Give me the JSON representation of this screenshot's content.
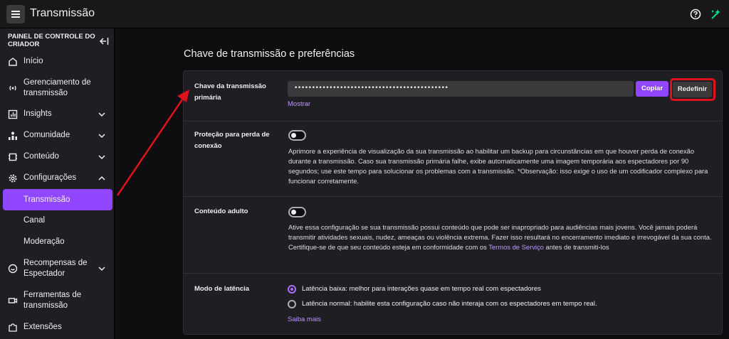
{
  "header": {
    "title": "Transmissão",
    "menu_icon": "hamburger-menu-icon",
    "help_icon": "help-icon",
    "magic_icon": "sparkle-icon"
  },
  "sidebar": {
    "heading": "PAINEL DE CONTROLE DO CRIADOR",
    "items": [
      {
        "label": "Início",
        "icon": "home-icon"
      },
      {
        "label": "Gerenciamento de transmissão",
        "icon": "broadcast-icon"
      },
      {
        "label": "Insights",
        "icon": "chart-icon"
      },
      {
        "label": "Comunidade",
        "icon": "community-icon"
      },
      {
        "label": "Conteúdo",
        "icon": "content-icon"
      },
      {
        "label": "Configurações",
        "icon": "gear-icon"
      },
      {
        "label": "Transmissão"
      },
      {
        "label": "Canal"
      },
      {
        "label": "Moderação"
      },
      {
        "label": "Recompensas de Espectador",
        "icon": "rewards-icon"
      },
      {
        "label": "Ferramentas de transmissão",
        "icon": "camera-icon"
      },
      {
        "label": "Extensões",
        "icon": "puzzle-icon"
      }
    ]
  },
  "main": {
    "title": "Chave de transmissão e preferências",
    "stream_key": {
      "label": "Chave da transmissão primária",
      "value": "••••••••••••••••••••••••••••••••••••••••••••",
      "copy_label": "Copiar",
      "reset_label": "Redefinir",
      "show_label": "Mostrar"
    },
    "disconnect": {
      "label": "Proteção para perda de conexão",
      "description": "Aprimore a experiência de visualização da sua transmissão ao habilitar um backup para circunstâncias em que houver perda de conexão durante a transmissão. Caso sua transmissão primária falhe, exibe automaticamente uma imagem temporária aos espectadores por 90 segundos; use este tempo para solucionar os problemas com a transmissão. *Observação: isso exige o uso de um codificador complexo para funcionar corretamente."
    },
    "mature": {
      "label": "Conteúdo adulto",
      "description_pre": "Ative essa configuração se sua transmissão possui conteúdo que pode ser inapropriado para audiências mais jovens. Você jamais poderá transmitir atividades sexuais, nudez, ameaças ou violência extrema. Fazer isso resultará no encerramento imediato e irrevogável da sua conta. Certifique-se de que seu conteúdo esteja em conformidade com os ",
      "tos_link": "Termos de Serviço",
      "description_post": " antes de transmiti-los"
    },
    "latency": {
      "label": "Modo de latência",
      "low": "Latência baixa: melhor para interações quase em tempo real com espectadores",
      "normal": "Latência normal: habilite esta configuração caso não interaja com os espectadores em tempo real.",
      "learn_more": "Saiba mais"
    }
  },
  "colors": {
    "accent": "#9147ff",
    "highlight": "#e0111d"
  }
}
